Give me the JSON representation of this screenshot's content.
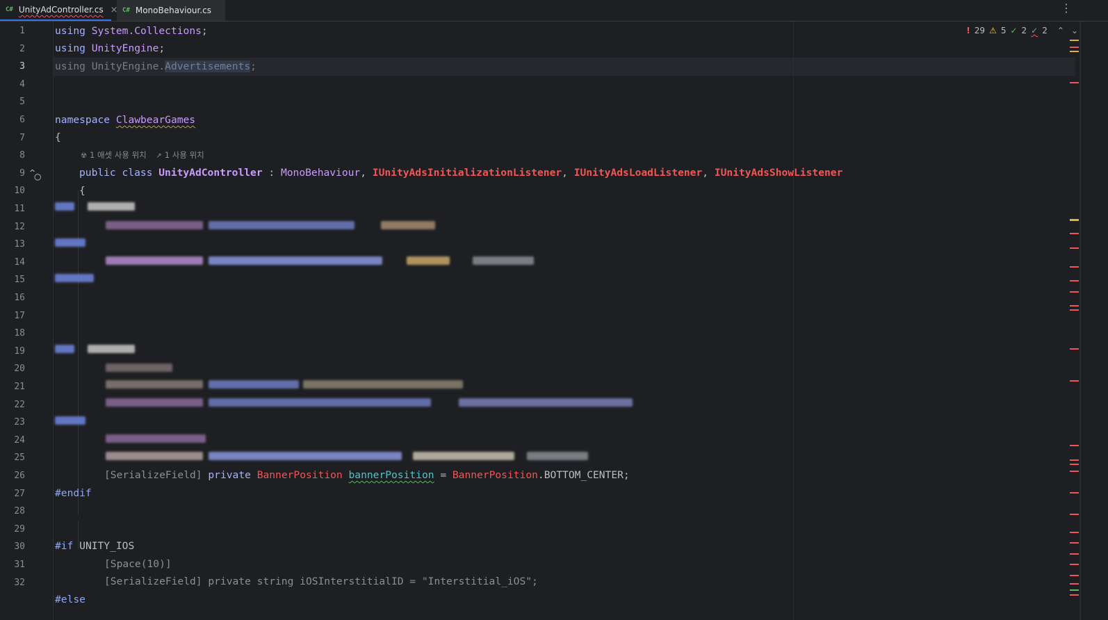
{
  "tabs": [
    {
      "lang": "C#",
      "title": "UnityAdController.cs",
      "close": "×"
    },
    {
      "lang": "C#",
      "title": "MonoBehaviour.cs"
    }
  ],
  "menu_icon": "⋮",
  "inspection": {
    "errors": "29",
    "warnings": "5",
    "ok": "2",
    "ok_typo": "2",
    "error_icon": "!",
    "warning_icon": "⚠",
    "check_icon": "✓",
    "up_icon": "⌃",
    "down_icon": "⌄"
  },
  "line_numbers": [
    "1",
    "2",
    "3",
    "4",
    "5",
    "6",
    "7",
    "8",
    "9",
    "10",
    "11",
    "12",
    "13",
    "14",
    "15",
    "16",
    "17",
    "18",
    "19",
    "20",
    "21",
    "22",
    "23",
    "24",
    "25",
    "26",
    "27",
    "28",
    "29",
    "30",
    "31",
    "32"
  ],
  "code": {
    "l1": {
      "kw": "using",
      "ns": "System.Collections",
      "end": ";"
    },
    "l2": {
      "kw": "using",
      "ns": "UnityEngine",
      "end": ";"
    },
    "l3": {
      "a": "using UnityEngine.",
      "b": "Advertisements",
      "c": ";"
    },
    "l6": {
      "kw": "namespace",
      "ns": "ClawbearGames"
    },
    "l7": "{",
    "hint": {
      "usages_icon": "☢",
      "usages": "1 애셋 사용 위치",
      "refs_icon": "↗",
      "refs": "1 사용 위치"
    },
    "l8": {
      "kw1": "public",
      "kw2": "class",
      "cls": "UnityAdController",
      "colon": " : ",
      "base": "MonoBehaviour",
      "i1": "IUnityAdsInitializationListener",
      "i2": "IUnityAdsLoadListener",
      "i3": "IUnityAdsShowListener",
      "comma": ", "
    },
    "l9": "{",
    "l25": {
      "attr": "[SerializeField]",
      "kw": "private",
      "type": "BannerPosition",
      "field": "bannerPosition",
      "eq": " = ",
      "val_type": "BannerPosition",
      "val": ".BOTTOM_CENTER;"
    },
    "l26": "#endif",
    "l29": {
      "pp": "#if",
      "sym": "UNITY_IOS"
    },
    "l30": "[Space(10)]",
    "l31": "[SerializeField] private string iOSInterstitialID = \"Interstitial_iOS\";",
    "l32": "#else"
  },
  "gutter_icons": {
    "override": "^",
    "implemented": "○"
  },
  "colors": {
    "background": "#1e1f22",
    "keyword": "#a3b3ff",
    "class": "#c99bff",
    "interface_error": "#f25555",
    "field": "#56c1c5",
    "accent": "#3574f0"
  }
}
